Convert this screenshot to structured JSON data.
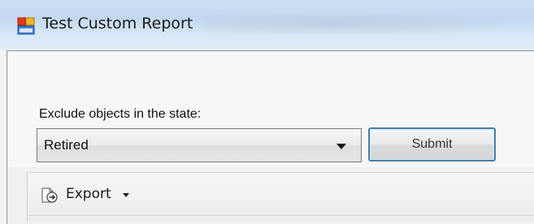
{
  "window": {
    "title": "Test Custom Report",
    "icon": "app-window-icon"
  },
  "form": {
    "exclude_label": "Exclude objects in the state:",
    "state_select": {
      "selected": "Retired"
    },
    "submit_label": "Submit"
  },
  "toolbar": {
    "export_label": "Export",
    "export_icon": "export-icon"
  },
  "colors": {
    "titlebar": "#c9dcf1",
    "button_border": "#4f7fa8",
    "panel": "#f0f0f0"
  }
}
